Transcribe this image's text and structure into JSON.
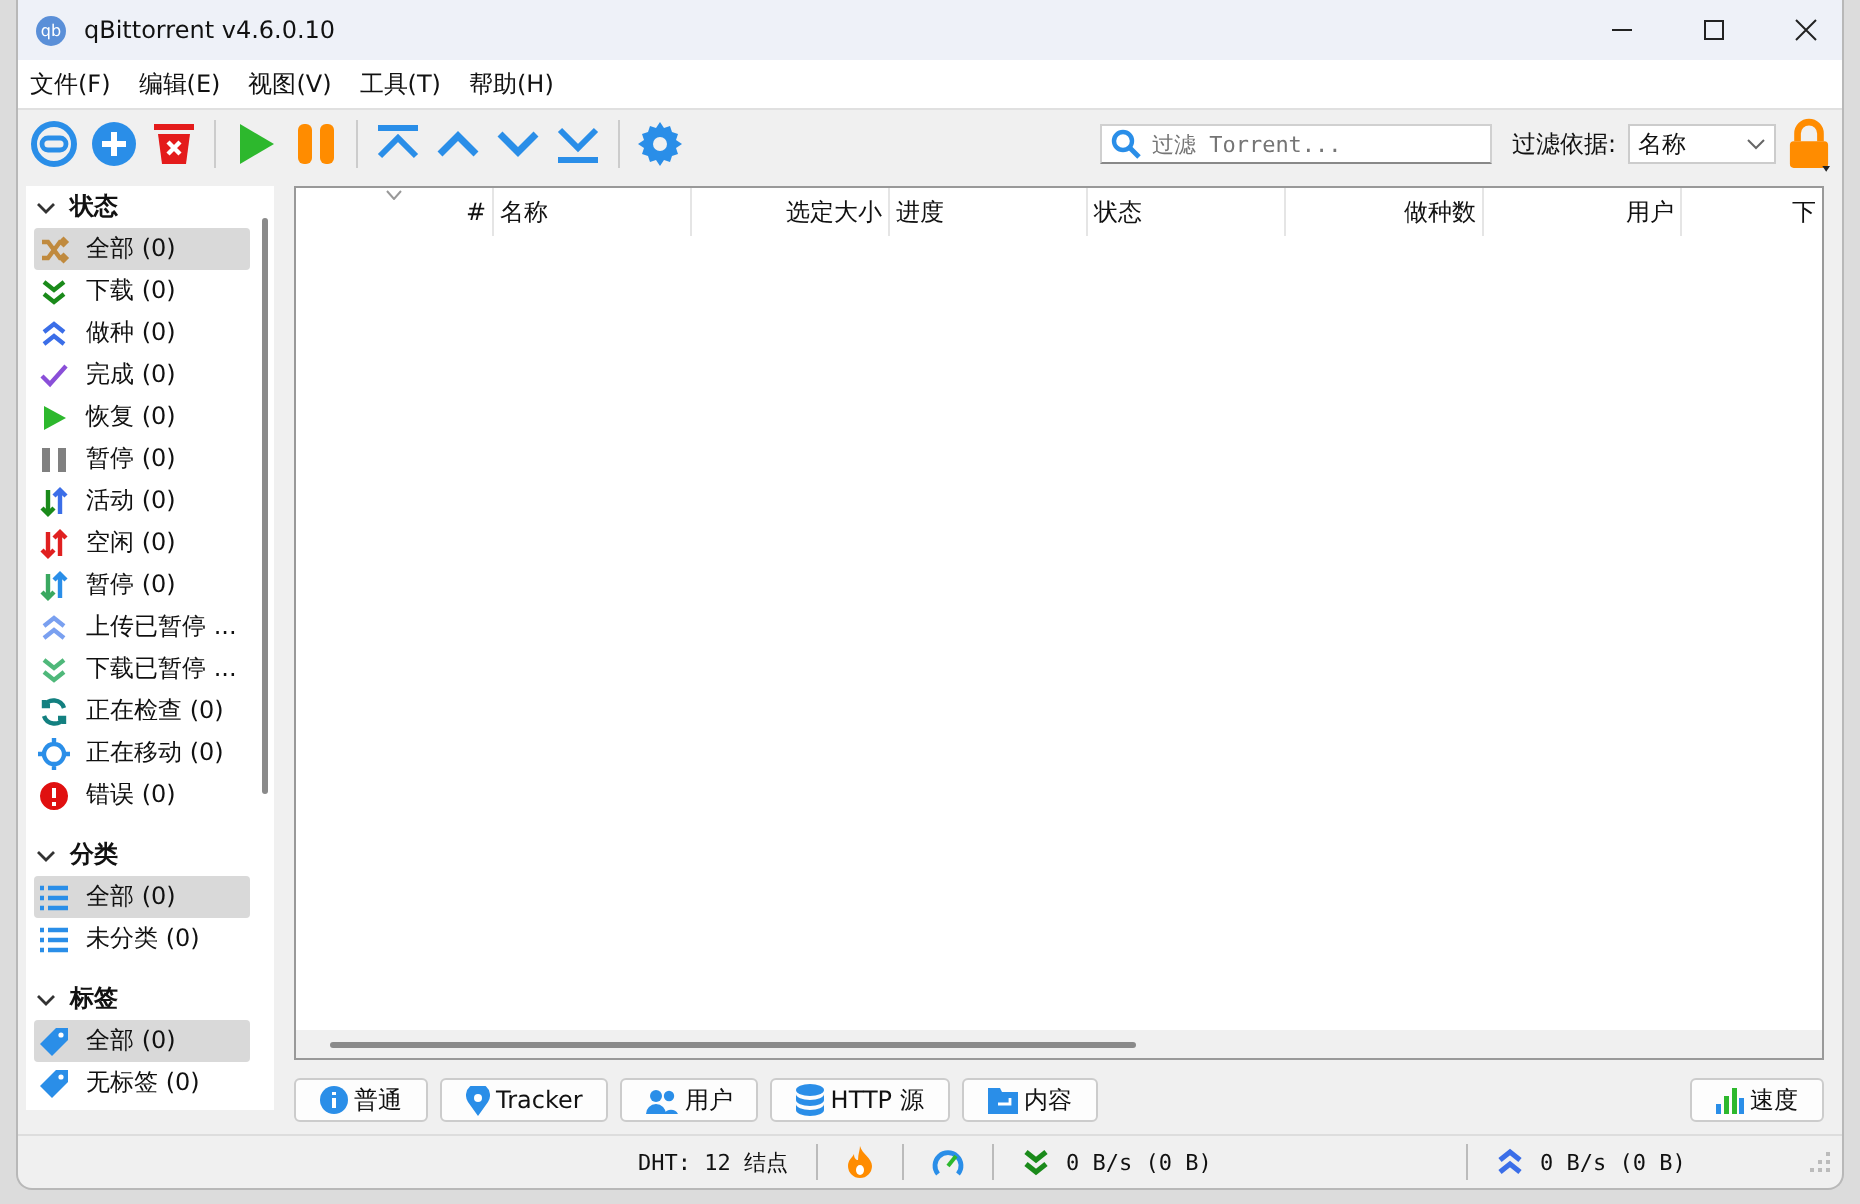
{
  "window": {
    "title": "qBittorrent v4.6.0.10",
    "app_icon_text": "qb"
  },
  "menu": [
    "文件(F)",
    "编辑(E)",
    "视图(V)",
    "工具(T)",
    "帮助(H)"
  ],
  "filter": {
    "placeholder": "过滤 Torrent...",
    "by_label": "过滤依据:",
    "by_value": "名称"
  },
  "sidebar": [
    {
      "title": "状态",
      "expanded": true,
      "items": [
        {
          "label": "全部 (0)",
          "kind": "shuffle",
          "selected": true
        },
        {
          "label": "下载 (0)",
          "kind": "down",
          "selected": false
        },
        {
          "label": "做种 (0)",
          "kind": "up",
          "selected": false
        },
        {
          "label": "完成 (0)",
          "kind": "check",
          "selected": false
        },
        {
          "label": "恢复 (0)",
          "kind": "play",
          "selected": false
        },
        {
          "label": "暂停 (0)",
          "kind": "pause",
          "selected": false
        },
        {
          "label": "活动 (0)",
          "kind": "active",
          "selected": false
        },
        {
          "label": "空闲 (0)",
          "kind": "idle",
          "selected": false
        },
        {
          "label": "暂停 (0)",
          "kind": "stalled",
          "selected": false
        },
        {
          "label": "上传已暂停 ...",
          "kind": "up-paused",
          "selected": false
        },
        {
          "label": "下载已暂停 ...",
          "kind": "down-paused",
          "selected": false
        },
        {
          "label": "正在检查 (0)",
          "kind": "checking",
          "selected": false
        },
        {
          "label": "正在移动 (0)",
          "kind": "moving",
          "selected": false
        },
        {
          "label": "错误 (0)",
          "kind": "error",
          "selected": false
        }
      ]
    },
    {
      "title": "分类",
      "expanded": true,
      "items": [
        {
          "label": "全部 (0)",
          "kind": "list",
          "selected": true
        },
        {
          "label": "未分类 (0)",
          "kind": "list",
          "selected": false
        }
      ]
    },
    {
      "title": "标签",
      "expanded": true,
      "items": [
        {
          "label": "全部 (0)",
          "kind": "tag",
          "selected": true
        },
        {
          "label": "无标签 (0)",
          "kind": "tag",
          "selected": false
        }
      ]
    }
  ],
  "table": {
    "columns": [
      {
        "label": "#",
        "kind": "number"
      },
      {
        "label": "名称",
        "kind": "text"
      },
      {
        "label": "选定大小",
        "kind": "number"
      },
      {
        "label": "进度",
        "kind": "text"
      },
      {
        "label": "状态",
        "kind": "text"
      },
      {
        "label": "做种数",
        "kind": "number"
      },
      {
        "label": "用户",
        "kind": "number"
      },
      {
        "label": "下",
        "kind": "number"
      }
    ]
  },
  "bottom_tabs": [
    {
      "label": "普通",
      "kind": "info"
    },
    {
      "label": "Tracker",
      "kind": "pin"
    },
    {
      "label": "用户",
      "kind": "people"
    },
    {
      "label": "HTTP 源",
      "kind": "database"
    },
    {
      "label": "内容",
      "kind": "folder"
    }
  ],
  "speed_button": {
    "label": "速度"
  },
  "status_bar": {
    "dht": "DHT: 12 结点",
    "download": "0 B/s (0 B)",
    "upload": "0 B/s (0 B)"
  }
}
